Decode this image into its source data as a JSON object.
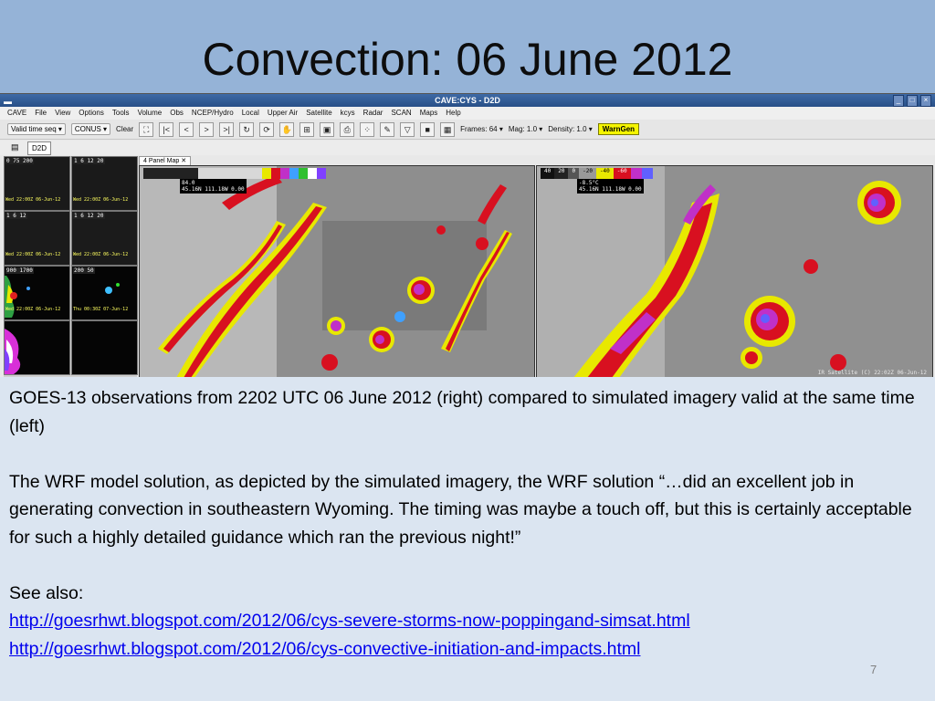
{
  "slide": {
    "title": "Convection:  06 June 2012",
    "page_number": "7"
  },
  "cave_window": {
    "title": "CAVE:CYS - D2D",
    "menu": [
      "CAVE",
      "File",
      "View",
      "Options",
      "Tools",
      "Volume",
      "Obs",
      "NCEP/Hydro",
      "Local",
      "Upper Air",
      "Satellite",
      "kcys",
      "Radar",
      "SCAN",
      "Maps",
      "Help"
    ],
    "toolbar": {
      "loop_mode": "Valid time seq",
      "scale": "CONUS",
      "clear_label": "Clear",
      "frames": "Frames: 64",
      "mag": "Mag: 1.0",
      "density": "Density: 1.0",
      "warngen": "WarnGen"
    },
    "perspective_tab": "D2D",
    "editor_tab": "4 Panel Map",
    "thumbnails": [
      {
        "label": "0  75  200",
        "stamp": "Wed 22:00Z 06-Jun-12"
      },
      {
        "label": "1  6  12  20",
        "stamp": "Wed 22:00Z 06-Jun-12"
      },
      {
        "label": "1  6  12",
        "stamp": "Wed 22:00Z 06-Jun-12"
      },
      {
        "label": "1  6  12  20",
        "stamp": "Wed 22:00Z 06-Jun-12"
      },
      {
        "label": "900  1700",
        "stamp": "Wed 22:00Z 06-Jun-12"
      },
      {
        "label": "200  50",
        "stamp": "Thu 00:30Z 07-Jun-12"
      },
      {
        "label": "",
        "stamp": ""
      },
      {
        "label": "",
        "stamp": ""
      }
    ],
    "left_panel": {
      "readout_value": "84.0",
      "readout_coords": "45.16N 111.18W 0.00"
    },
    "right_panel": {
      "scale_labels": [
        "40",
        "20",
        "0",
        "-20",
        "-40",
        "-60"
      ],
      "readout_value": "-8.5°C",
      "readout_coords": "45.16N 111.18W 0.00",
      "stamp": "IR Satellite (C) 22:02Z 06-Jun-12"
    }
  },
  "caption": {
    "para1": "GOES-13 observations from 2202 UTC 06 June 2012 (right) compared to simulated imagery valid at the same time (left)",
    "para2": "The WRF model solution, as depicted by the simulated imagery, the WRF solution “…did an excellent job in generating convection in southeastern Wyoming.  The timing was maybe a touch off, but this is certainly acceptable for such a highly detailed guidance which ran the previous night!”",
    "see_also": "See also:",
    "link1": "http://goesrhwt.blogspot.com/2012/06/cys-severe-storms-now-poppingand-simsat.html",
    "link2": "http://goesrhwt.blogspot.com/2012/06/cys-convective-initiation-and-impacts.html"
  },
  "colors": {
    "header_band": "#95b3d7",
    "slide_bg": "#dbe5f1",
    "link": "#0000ee"
  }
}
